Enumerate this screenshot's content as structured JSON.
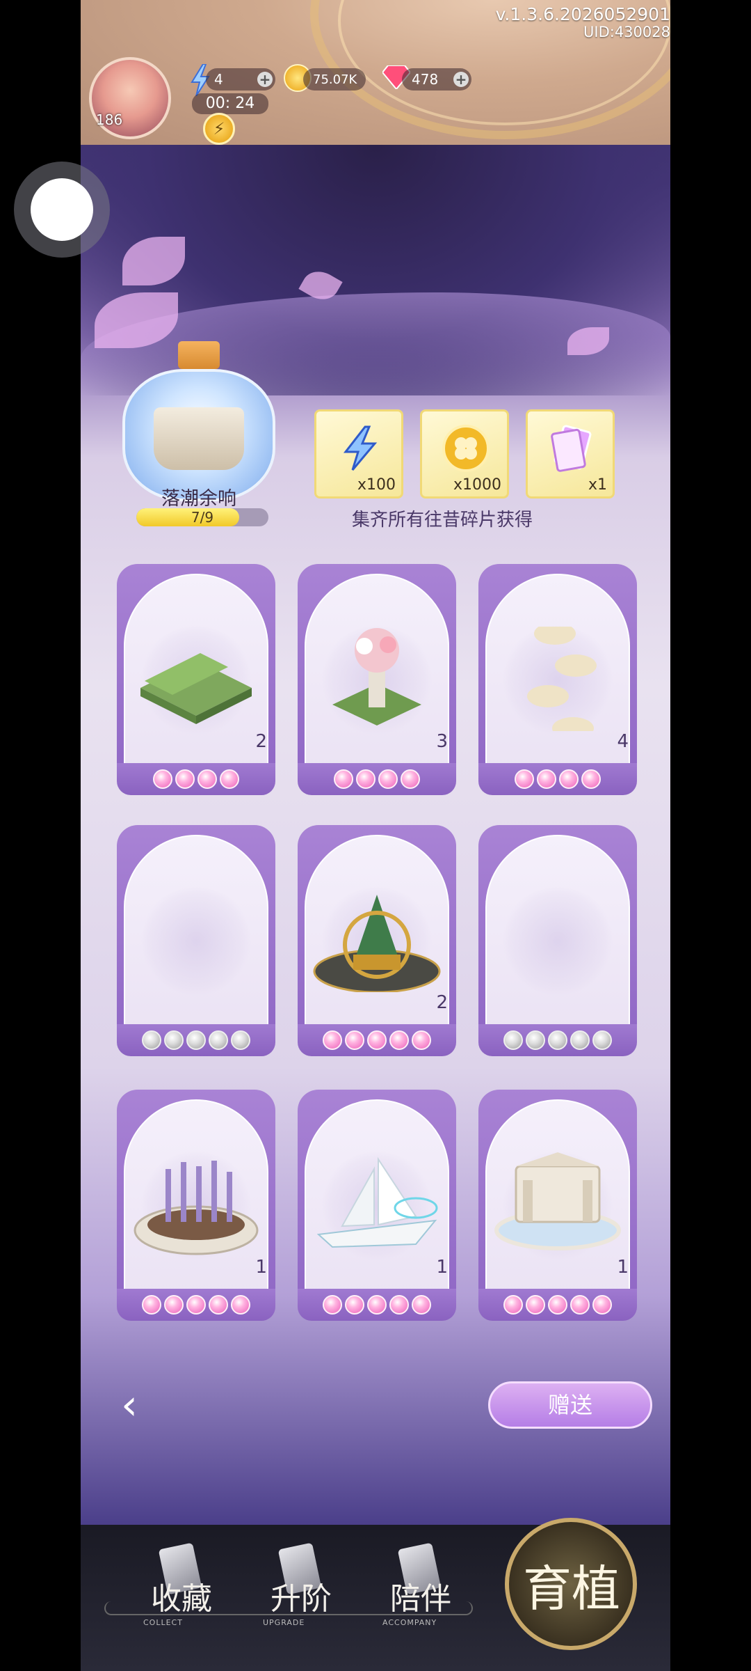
{
  "header": {
    "version": "v.1.3.6.2026052901",
    "uid": "UID:430028",
    "avatar_level": "186",
    "energy": "4",
    "coins": "75.07K",
    "gems": "478",
    "timer": "00: 24"
  },
  "album": {
    "name": "落潮余响",
    "progress_text": "7/9",
    "progress_value": 0.78,
    "collect_caption": "集齐所有往昔碎片获得"
  },
  "rewards": [
    {
      "icon": "lightning-bolt-icon",
      "qty": "x100"
    },
    {
      "icon": "gold-clover-coin-icon",
      "qty": "x1000"
    },
    {
      "icon": "card-pack-icon",
      "qty": "x1"
    }
  ],
  "cards": [
    {
      "item": "hedge-garden",
      "count": "2",
      "stars": 4,
      "owned": true
    },
    {
      "item": "flower-urn-planter",
      "count": "3",
      "stars": 4,
      "owned": true
    },
    {
      "item": "stepping-stones",
      "count": "4",
      "stars": 4,
      "owned": true
    },
    {
      "item": "empty-slot",
      "count": "",
      "stars": 5,
      "owned": false
    },
    {
      "item": "golden-armillary-tree",
      "count": "2",
      "stars": 5,
      "owned": true
    },
    {
      "item": "empty-slot",
      "count": "",
      "stars": 5,
      "owned": false
    },
    {
      "item": "lavender-planter",
      "count": "1",
      "stars": 5,
      "owned": true
    },
    {
      "item": "sailing-ship-fountain",
      "count": "1",
      "stars": 5,
      "owned": true
    },
    {
      "item": "marble-fountain",
      "count": "1",
      "stars": 5,
      "owned": true
    }
  ],
  "actions": {
    "back_icon": "chevron-left-icon",
    "gift_label": "赠送"
  },
  "nav": {
    "tabs": [
      {
        "label": "收藏",
        "en": "COLLECT"
      },
      {
        "label": "升阶",
        "en": "UPGRADE"
      },
      {
        "label": "陪伴",
        "en": "ACCOMPANY"
      }
    ],
    "active_label": "育植"
  }
}
